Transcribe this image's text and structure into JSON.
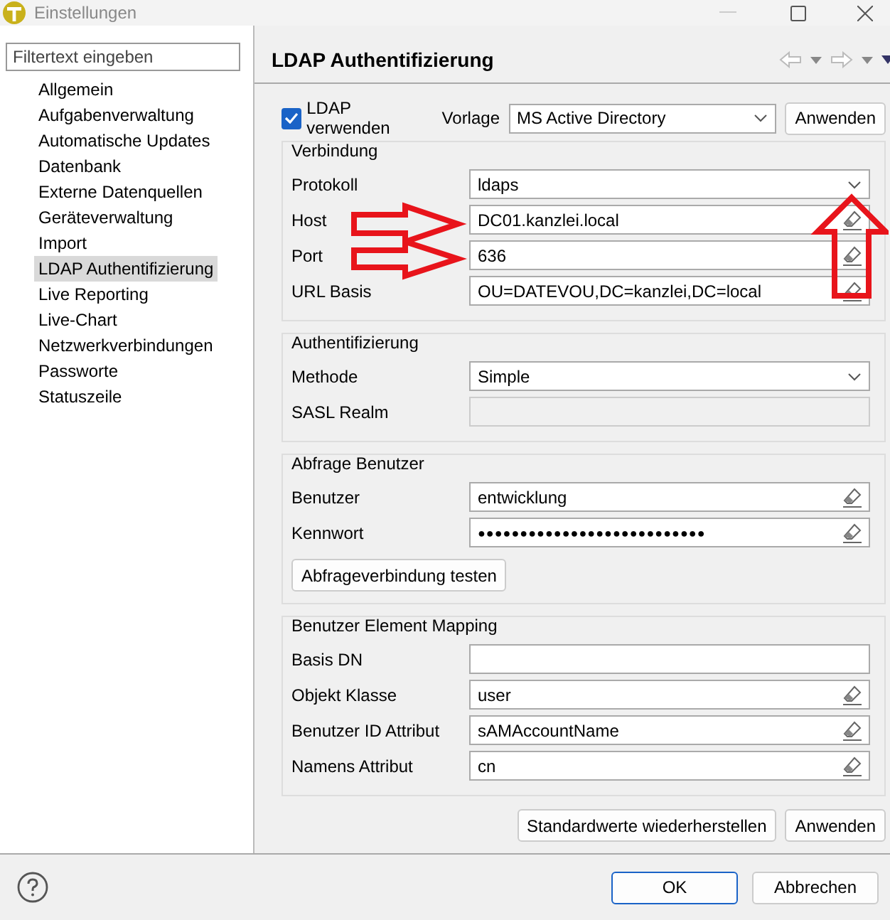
{
  "window": {
    "title": "Einstellungen"
  },
  "sidebar": {
    "filter_placeholder": "Filtertext eingeben",
    "items": [
      {
        "label": "Allgemein",
        "selected": false
      },
      {
        "label": "Aufgabenverwaltung",
        "selected": false
      },
      {
        "label": "Automatische Updates",
        "selected": false
      },
      {
        "label": "Datenbank",
        "selected": false
      },
      {
        "label": "Externe Datenquellen",
        "selected": false
      },
      {
        "label": "Geräteverwaltung",
        "selected": false
      },
      {
        "label": "Import",
        "selected": false
      },
      {
        "label": "LDAP Authentifizierung",
        "selected": true
      },
      {
        "label": "Live Reporting",
        "selected": false
      },
      {
        "label": "Live-Chart",
        "selected": false
      },
      {
        "label": "Netzwerkverbindungen",
        "selected": false
      },
      {
        "label": "Passworte",
        "selected": false
      },
      {
        "label": "Statuszeile",
        "selected": false
      }
    ]
  },
  "page": {
    "title": "LDAP Authentifizierung",
    "use_ldap": {
      "label": "LDAP verwenden",
      "checked": true
    },
    "template": {
      "label": "Vorlage",
      "value": "MS Active Directory",
      "button": "Anwenden"
    },
    "groups": [
      {
        "title": "Verbindung",
        "rows": [
          {
            "kind": "select",
            "label": "Protokoll",
            "value": "ldaps"
          },
          {
            "kind": "text",
            "label": "Host",
            "value": "DC01.kanzlei.local",
            "clearable": true
          },
          {
            "kind": "text",
            "label": "Port",
            "value": "636",
            "clearable": true
          },
          {
            "kind": "text",
            "label": "URL Basis",
            "value": "OU=DATEVOU,DC=kanzlei,DC=local",
            "clearable": true
          }
        ]
      },
      {
        "title": "Authentifizierung",
        "rows": [
          {
            "kind": "select",
            "label": "Methode",
            "value": "Simple"
          },
          {
            "kind": "disabled",
            "label": "SASL Realm"
          }
        ]
      },
      {
        "title": "Abfrage Benutzer",
        "rows": [
          {
            "kind": "text",
            "label": "Benutzer",
            "value": "entwicklung",
            "clearable": true
          },
          {
            "kind": "text",
            "label": "Kennwort",
            "value": "●●●●●●●●●●●●●●●●●●●●●●●●●●●",
            "clearable": true
          }
        ],
        "button": "Abfrageverbindung testen"
      },
      {
        "title": "Benutzer Element Mapping",
        "rows": [
          {
            "kind": "text",
            "label": "Basis DN",
            "clearable": false
          },
          {
            "kind": "text",
            "label": "Objekt Klasse",
            "value": "user",
            "clearable": true
          },
          {
            "kind": "text",
            "label": "Benutzer ID Attribut",
            "value": "sAMAccountName",
            "clearable": true
          },
          {
            "kind": "text",
            "label": "Namens Attribut",
            "value": "cn",
            "clearable": true
          }
        ]
      }
    ],
    "buttons": [
      "Standardwerte wiederherstellen",
      "Anwenden"
    ]
  },
  "footer": {
    "buttons": [
      "OK",
      "Abbrechen"
    ]
  }
}
